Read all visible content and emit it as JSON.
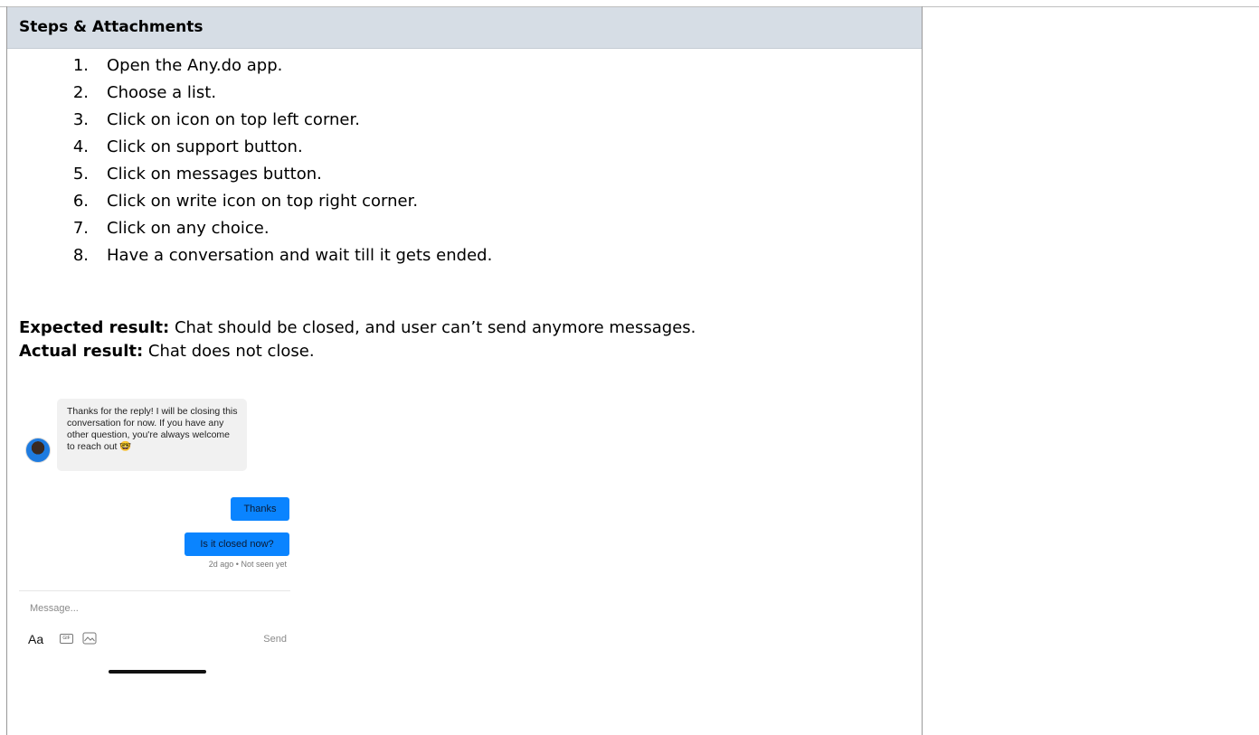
{
  "section": {
    "title": "Steps & Attachments"
  },
  "steps": [
    {
      "num": "1.",
      "text": "Open the Any.do app."
    },
    {
      "num": "2.",
      "text": "Choose a list."
    },
    {
      "num": "3.",
      "text": "Click on icon on top left corner."
    },
    {
      "num": "4.",
      "text": "Click on support button."
    },
    {
      "num": "5.",
      "text": "Click on messages button."
    },
    {
      "num": "6.",
      "text": "Click on write icon on top right corner."
    },
    {
      "num": "7.",
      "text": "Click on any choice."
    },
    {
      "num": "8.",
      "text": "Have a conversation and wait till it gets ended."
    }
  ],
  "results": {
    "expected_label": "Expected result:",
    "expected_text": " Chat should be closed, and user can’t send anymore messages.",
    "actual_label": "Actual result:",
    "actual_text": " Chat does not close."
  },
  "chat": {
    "incoming_message": "Thanks for the reply! I will be closing this conversation for now. If you have any other question, you're always welcome to reach out 🤓",
    "outgoing_messages": [
      "Thanks",
      "Is it closed now?"
    ],
    "status": "2d ago • Not seen yet",
    "composer_placeholder": "Message...",
    "format_label": "Aa",
    "gif_label": "GIF",
    "send_label": "Send"
  },
  "colors": {
    "header_bg": "#d6dde5",
    "bubble_out": "#0a84ff",
    "bubble_in": "#f1f1f1"
  }
}
